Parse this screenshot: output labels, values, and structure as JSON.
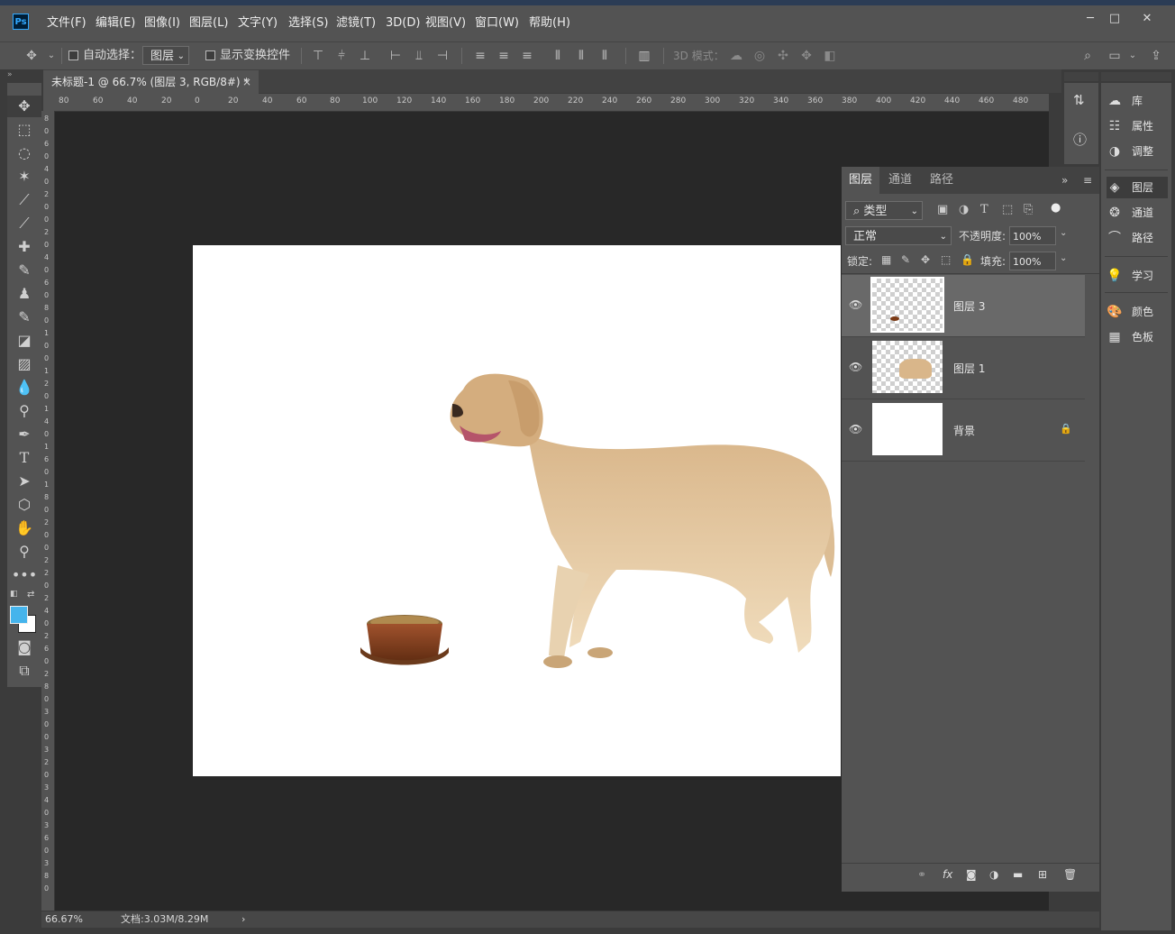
{
  "app": {
    "logo": "Ps"
  },
  "menu": [
    "文件(F)",
    "编辑(E)",
    "图像(I)",
    "图层(L)",
    "文字(Y)",
    "选择(S)",
    "滤镜(T)",
    "3D(D)",
    "视图(V)",
    "窗口(W)",
    "帮助(H)"
  ],
  "window_controls": {
    "minimize": "─",
    "maximize": "□",
    "close": "✕"
  },
  "options": {
    "auto_select_label": "自动选择：",
    "auto_select_value": "图层",
    "show_transform_label": "显示变换控件",
    "mode3d_label": "3D 模式："
  },
  "document": {
    "tab_title": "未标题-1 @ 66.7% (图层 3, RGB/8#) *",
    "close": "×"
  },
  "ruler": {
    "h": [
      "80",
      "60",
      "40",
      "20",
      "0",
      "20",
      "40",
      "60",
      "80",
      "100",
      "120",
      "140",
      "160",
      "180",
      "200",
      "220",
      "240",
      "260",
      "280",
      "300",
      "320",
      "340",
      "360",
      "380",
      "400",
      "420",
      "440",
      "460",
      "480"
    ],
    "v": [
      "8",
      "0",
      "6",
      "0",
      "4",
      "0",
      "2",
      "0",
      "0",
      "2",
      "0",
      "4",
      "0",
      "6",
      "0",
      "8",
      "0",
      "1",
      "0",
      "0",
      "1",
      "2",
      "0",
      "1",
      "4",
      "0",
      "1",
      "6",
      "0",
      "1",
      "8",
      "0",
      "2",
      "0",
      "0",
      "2",
      "2",
      "0",
      "2",
      "4",
      "0",
      "2",
      "6",
      "0",
      "2",
      "8",
      "0",
      "3",
      "0",
      "0",
      "3",
      "2",
      "0",
      "3",
      "4",
      "0",
      "3",
      "6",
      "0",
      "3",
      "8",
      "0"
    ]
  },
  "status": {
    "zoom": "66.67%",
    "doc_info": "文档:3.03M/8.29M",
    "arrow": "›"
  },
  "layers_panel": {
    "tabs": [
      "图层",
      "通道",
      "路径"
    ],
    "filter_label": "类型",
    "blend_mode": "正常",
    "opacity_label": "不透明度:",
    "opacity_value": "100%",
    "lock_label": "锁定:",
    "fill_label": "填充:",
    "fill_value": "100%",
    "layers": [
      {
        "name": "图层 3",
        "selected": true
      },
      {
        "name": "图层 1",
        "selected": false
      },
      {
        "name": "背景",
        "selected": false,
        "locked": true
      }
    ],
    "footer_icons": [
      "link-icon",
      "fx-icon",
      "mask-icon",
      "adjustment-icon",
      "folder-icon",
      "new-layer-icon",
      "trash-icon"
    ]
  },
  "dock": {
    "items": [
      "库",
      "属性",
      "调整",
      "图层",
      "通道",
      "路径",
      "学习",
      "颜色",
      "色板"
    ]
  },
  "colors": {
    "foreground": "#45b4ec",
    "background": "#ffffff",
    "panel_bg": "#535353",
    "canvas_bg": "#282828"
  }
}
